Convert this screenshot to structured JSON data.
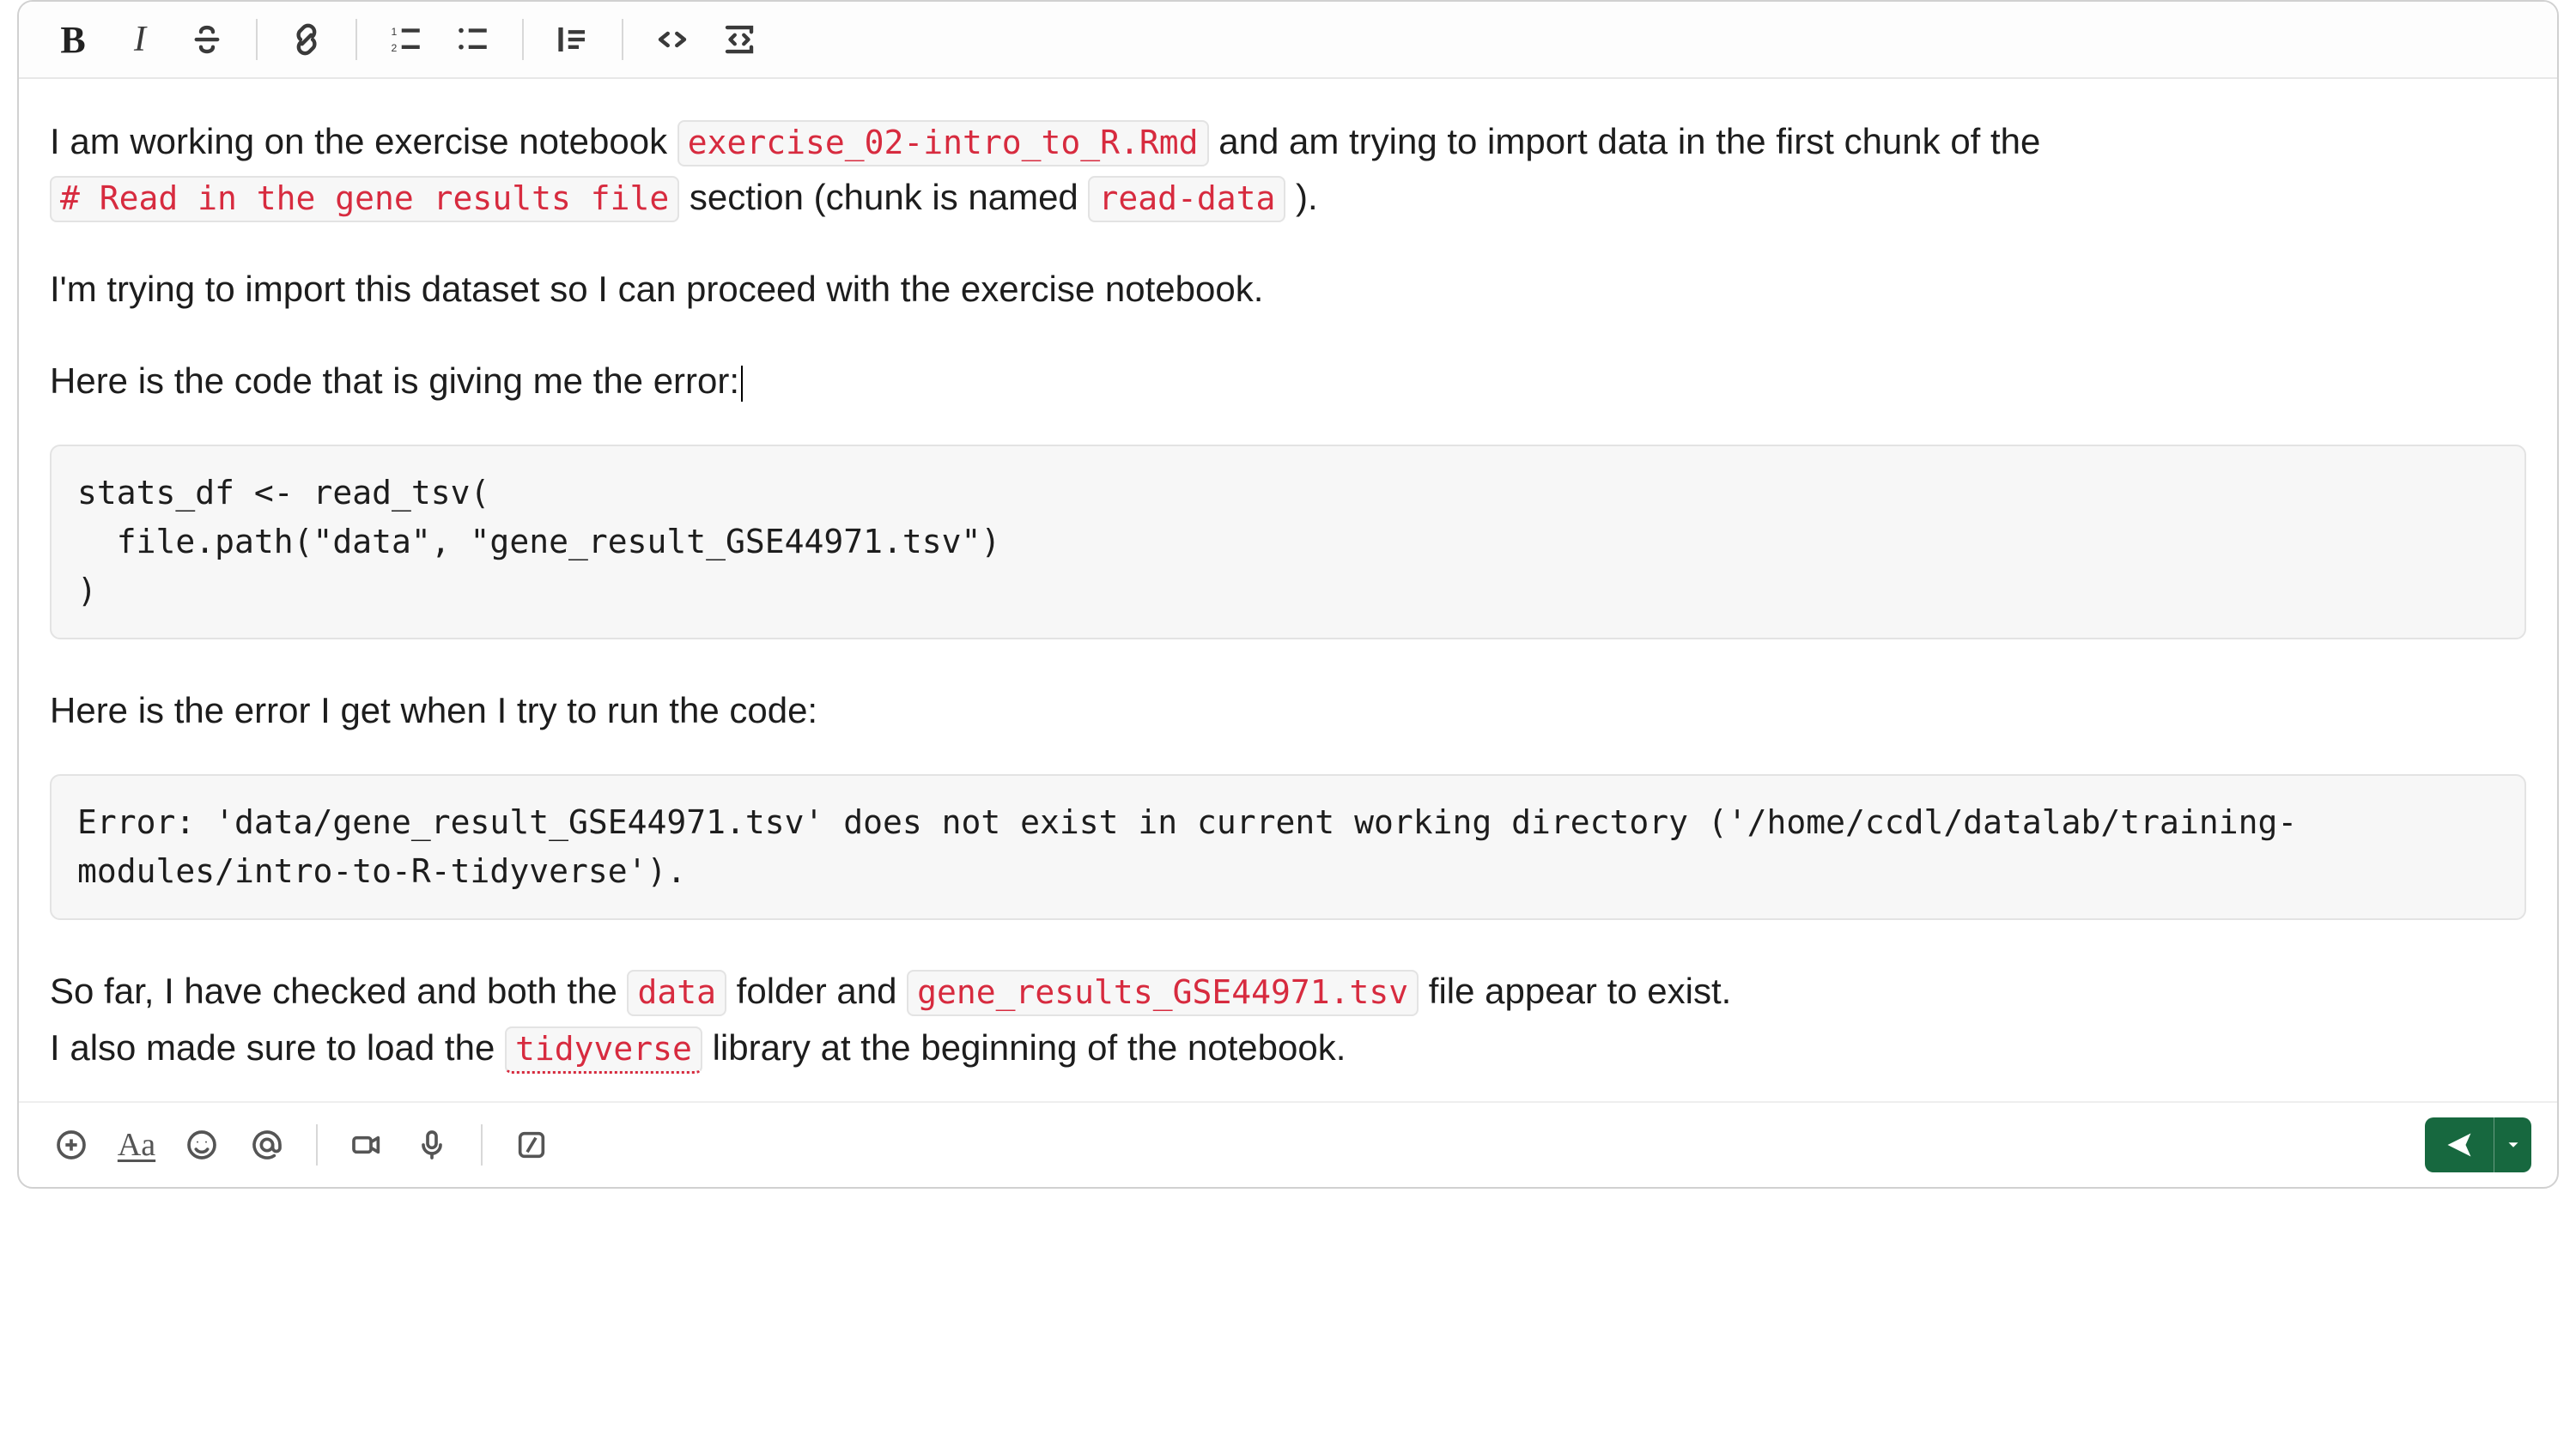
{
  "body": {
    "p1_lead": "I am working on the exercise notebook ",
    "code_notebook": "exercise_02-intro_to_R.Rmd",
    "p1_mid": " and am trying to import data in the first chunk of the ",
    "code_section": "# Read in the gene results file",
    "p1_after_section": " section (chunk is named ",
    "code_chunkname": "read-data",
    "p1_tail": " ).",
    "p2": "I'm trying to import this dataset so I can proceed with the exercise notebook.",
    "p3": "Here is the code that is giving me the error:",
    "codeblock1": "stats_df <- read_tsv(\n  file.path(\"data\", \"gene_result_GSE44971.tsv\")\n)",
    "p4": "Here is the error I get when I try to run the code:",
    "codeblock2": "Error: 'data/gene_result_GSE44971.tsv' does not exist in current working directory ('/home/ccdl/datalab/training-\nmodules/intro-to-R-tidyverse').",
    "p5_lead": "So far, I have checked and both the ",
    "code_data": "data",
    "p5_mid1": " folder and ",
    "code_file": "gene_results_GSE44971.tsv",
    "p5_mid2": " file appear to exist.",
    "p5_line2_lead": "I also made sure to load the ",
    "code_tidyverse": "tidyverse",
    "p5_line2_tail": " library at the beginning of the notebook."
  }
}
